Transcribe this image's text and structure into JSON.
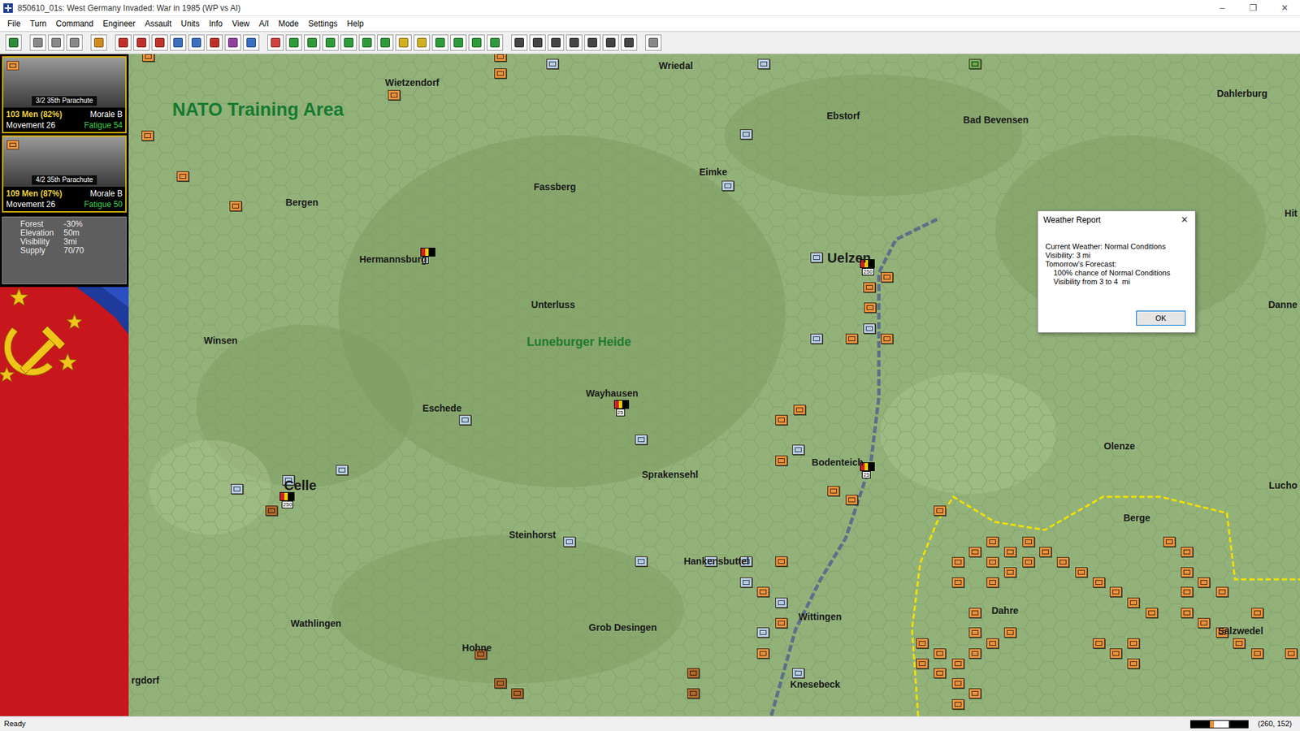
{
  "window": {
    "title": "850610_01s: West Germany Invaded: War in 1985 (WP vs AI)",
    "controls": [
      "–",
      "❐",
      "✕"
    ]
  },
  "menu": [
    {
      "label": "File"
    },
    {
      "label": "Turn"
    },
    {
      "label": "Command"
    },
    {
      "label": "Engineer"
    },
    {
      "label": "Assault"
    },
    {
      "label": "Units"
    },
    {
      "label": "Info"
    },
    {
      "label": "View"
    },
    {
      "label": "A/I"
    },
    {
      "label": "Mode"
    },
    {
      "label": "Settings"
    },
    {
      "label": "Help"
    }
  ],
  "units_panel": [
    {
      "label": "3/2 35th Parachute",
      "men": "103 Men (82%)",
      "morale": "Morale B",
      "movement": "Movement 26",
      "fatigue": "Fatigue 54",
      "selected": true
    },
    {
      "label": "4/2 35th Parachute",
      "men": "109 Men (87%)",
      "morale": "Morale B",
      "movement": "Movement 26",
      "fatigue": "Fatigue 50",
      "selected": true
    }
  ],
  "terrain": [
    {
      "label": "Forest",
      "value": "-30%"
    },
    {
      "label": "Elevation",
      "value": "50m"
    },
    {
      "label": "Visibility",
      "value": "3mi"
    },
    {
      "label": "Supply",
      "value": "70/70"
    }
  ],
  "map": {
    "towns": [
      {
        "name": "Wriedal",
        "kind": "town"
      },
      {
        "name": "Wietzendorf",
        "kind": "town"
      },
      {
        "name": "Ebstorf",
        "kind": "town"
      },
      {
        "name": "Bad Bevensen",
        "kind": "town"
      },
      {
        "name": "Dahlerburg",
        "kind": "town"
      },
      {
        "name": "Eimke",
        "kind": "town"
      },
      {
        "name": "Fassberg",
        "kind": "town"
      },
      {
        "name": "Bergen",
        "kind": "town"
      },
      {
        "name": "Hermannsburg",
        "kind": "town"
      },
      {
        "name": "Uelzen",
        "kind": "city"
      },
      {
        "name": "Unterluss",
        "kind": "town"
      },
      {
        "name": "Winsen",
        "kind": "town"
      },
      {
        "name": "Wayhausen",
        "kind": "town"
      },
      {
        "name": "Eschede",
        "kind": "town"
      },
      {
        "name": "Bodenteich",
        "kind": "town"
      },
      {
        "name": "Olenze",
        "kind": "town"
      },
      {
        "name": "Celle",
        "kind": "city"
      },
      {
        "name": "Sprakensehl",
        "kind": "town"
      },
      {
        "name": "Steinhorst",
        "kind": "town"
      },
      {
        "name": "Hankensbuttel",
        "kind": "town"
      },
      {
        "name": "Berge",
        "kind": "town"
      },
      {
        "name": "Dahre",
        "kind": "town"
      },
      {
        "name": "Wittingen",
        "kind": "town"
      },
      {
        "name": "Salzwedel",
        "kind": "town"
      },
      {
        "name": "Wathlingen",
        "kind": "town"
      },
      {
        "name": "Hohne",
        "kind": "town"
      },
      {
        "name": "Grob Desingen",
        "kind": "town"
      },
      {
        "name": "Knesebeck",
        "kind": "town"
      },
      {
        "name": "rgdorf",
        "kind": "town"
      },
      {
        "name": "Hit",
        "kind": "town"
      },
      {
        "name": "Danne",
        "kind": "town"
      },
      {
        "name": "Lucho",
        "kind": "town"
      },
      {
        "name": "NATO Training Area",
        "kind": "area"
      },
      {
        "name": "Luneburger Heide",
        "kind": "region"
      }
    ],
    "units": [
      {
        "color": "#e8913c"
      },
      {
        "color": "#e8913c"
      },
      {
        "color": "#e8913c"
      },
      {
        "color": "#e8913c"
      },
      {
        "color": "#e8913c"
      },
      {
        "color": "#e8913c"
      },
      {
        "color": "#e8913c"
      },
      {
        "color": "#e8913c"
      },
      {
        "color": "#e8913c"
      },
      {
        "color": "#e8913c"
      },
      {
        "color": "#e8913c"
      },
      {
        "color": "#e8913c"
      },
      {
        "color": "#e8913c"
      },
      {
        "color": "#e8913c"
      },
      {
        "color": "#e8913c"
      },
      {
        "color": "#e8913c"
      },
      {
        "color": "#e8913c"
      },
      {
        "color": "#e8913c"
      },
      {
        "color": "#e8913c"
      },
      {
        "color": "#e8913c"
      },
      {
        "color": "#e8913c"
      },
      {
        "color": "#e8913c"
      },
      {
        "color": "#e8913c"
      },
      {
        "color": "#e8913c"
      },
      {
        "color": "#e8913c"
      },
      {
        "color": "#e8913c"
      },
      {
        "color": "#e8913c"
      },
      {
        "color": "#e8913c"
      },
      {
        "color": "#e8913c"
      },
      {
        "color": "#e8913c"
      },
      {
        "color": "#e8913c"
      },
      {
        "color": "#e8913c"
      },
      {
        "color": "#e8913c"
      },
      {
        "color": "#e8913c"
      },
      {
        "color": "#e8913c"
      },
      {
        "color": "#e8913c"
      },
      {
        "color": "#e8913c"
      },
      {
        "color": "#e8913c"
      },
      {
        "color": "#e8913c"
      },
      {
        "color": "#e8913c"
      },
      {
        "color": "#e8913c"
      },
      {
        "color": "#e8913c"
      },
      {
        "color": "#e8913c"
      },
      {
        "color": "#e8913c"
      },
      {
        "color": "#e8913c"
      },
      {
        "color": "#e8913c"
      },
      {
        "color": "#e8913c"
      },
      {
        "color": "#e8913c"
      },
      {
        "color": "#e8913c"
      },
      {
        "color": "#e8913c"
      },
      {
        "color": "#e8913c"
      },
      {
        "color": "#e8913c"
      },
      {
        "color": "#e8913c"
      },
      {
        "color": "#e8913c"
      },
      {
        "color": "#e8913c"
      },
      {
        "color": "#e8913c"
      },
      {
        "color": "#e8913c"
      },
      {
        "color": "#e8913c"
      },
      {
        "color": "#e8913c"
      },
      {
        "color": "#e8913c"
      },
      {
        "color": "#e8913c"
      },
      {
        "color": "#e8913c"
      },
      {
        "color": "#e8913c"
      },
      {
        "color": "#e8913c"
      },
      {
        "color": "#e8913c"
      },
      {
        "color": "#e8913c"
      },
      {
        "color": "#e8913c"
      },
      {
        "color": "#e8913c"
      },
      {
        "color": "#e8913c"
      },
      {
        "color": "#b0682c"
      },
      {
        "color": "#b0682c"
      },
      {
        "color": "#b0682c"
      },
      {
        "color": "#b0682c"
      },
      {
        "color": "#b0682c"
      },
      {
        "color": "#b0682c"
      },
      {
        "color": "#b5cbe3"
      },
      {
        "color": "#b5cbe3"
      },
      {
        "color": "#b5cbe3"
      },
      {
        "color": "#b5cbe3"
      },
      {
        "color": "#b5cbe3"
      },
      {
        "color": "#b5cbe3"
      },
      {
        "color": "#b5cbe3"
      },
      {
        "color": "#b5cbe3"
      },
      {
        "color": "#b5cbe3"
      },
      {
        "color": "#b5cbe3"
      },
      {
        "color": "#b5cbe3"
      },
      {
        "color": "#b5cbe3"
      },
      {
        "color": "#b5cbe3"
      },
      {
        "color": "#b5cbe3"
      },
      {
        "color": "#b5cbe3"
      },
      {
        "color": "#b5cbe3"
      },
      {
        "color": "#b5cbe3"
      },
      {
        "color": "#b5cbe3"
      },
      {
        "color": "#b5cbe3"
      },
      {
        "color": "#b5cbe3"
      },
      {
        "color": "#b5cbe3"
      },
      {
        "color": "#6aa84f"
      }
    ],
    "headquarters": [
      {
        "label": "0"
      },
      {
        "label": "25"
      },
      {
        "label": "250"
      },
      {
        "label": "25"
      },
      {
        "label": "250"
      }
    ]
  },
  "dialog": {
    "title": "Weather Report",
    "close": "✕",
    "lines": [
      {
        "text": "Current Weather: Normal Conditions",
        "kind": "line"
      },
      {
        "text": "Visibility: 3 mi",
        "kind": "line"
      },
      {
        "text": "Tomorrow's Forecast:",
        "kind": "line"
      },
      {
        "text": "100% chance of Normal Conditions",
        "kind": "sub"
      },
      {
        "text": "Visibility from 3 to 4  mi",
        "kind": "sub"
      }
    ],
    "button": "OK"
  },
  "status_bar": {
    "text": "Ready",
    "coords": "(260, 152)"
  }
}
